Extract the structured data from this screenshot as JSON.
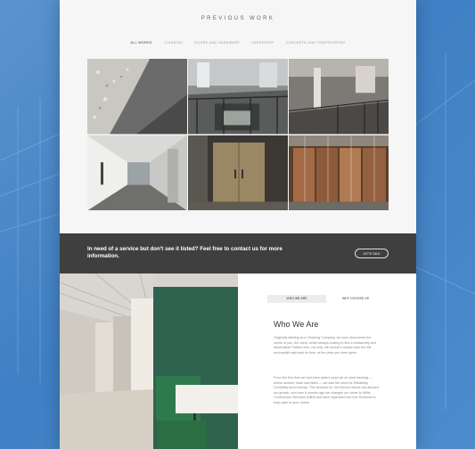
{
  "header": {
    "title": "PREVIOUS WORK"
  },
  "filters": [
    "ALL WORKS",
    "CLEANING",
    "DOORS AND HARDWARE",
    "CARPENTRY",
    "CONCRETE AND FIREPROOFING"
  ],
  "gallery": [
    {
      "name": "concrete-texture"
    },
    {
      "name": "stairwell-railing"
    },
    {
      "name": "mezzanine-railing"
    },
    {
      "name": "corridor"
    },
    {
      "name": "wood-doors"
    },
    {
      "name": "wood-wall-panels"
    }
  ],
  "banner": {
    "message": "In need of a service but don't see it listed? Feel free to contact us for more information.",
    "button": "LET'S TALK"
  },
  "about": {
    "tabs": [
      "WHO WE ARE",
      "WHY CHOOSE US"
    ],
    "heading": "Who We Are",
    "p1": "Originally starting as a Cleaning Company, we soon discovered the needs of you, the client, which always looking to find a trustworthy and dependable Partner who, not only, will accept a unique task but will accomplish said task on time, at the price you were given.",
    "p2": "From the first time we had been asked could we do steel backing — where another trade had fallen — we saw the need for Reliability, Credibility and Honesty. This demand for Old School Values has allowed our growth, and over 6 months ago we changed our name to Willis Construction Services (DBA) and have organized into four Divisions to help cater to your needs."
  }
}
